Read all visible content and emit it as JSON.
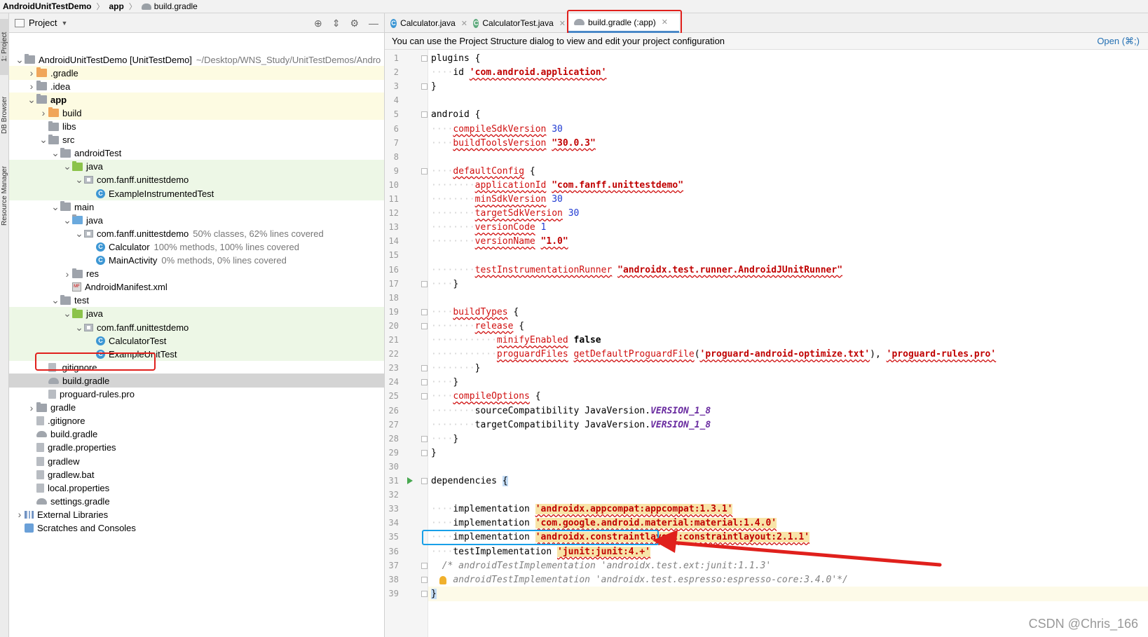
{
  "breadcrumb": {
    "project": "AndroidUnitTestDemo",
    "module": "app",
    "file": "build.gradle"
  },
  "left_strip": {
    "tab1": "1: Project",
    "tab2": "DB Browser",
    "tab3": "Resource Manager"
  },
  "project_panel": {
    "title": "Project"
  },
  "tree": [
    {
      "label": "AndroidUnitTestDemo [UnitTestDemo]",
      "hint": "~/Desktop/WNS_Study/UnitTestDemos/Andro",
      "icon": "module-folder-icon",
      "bold_part": true
    },
    {
      "label": ".gradle",
      "icon": "folder-icon"
    },
    {
      "label": ".idea",
      "icon": "folder-icon"
    },
    {
      "label": "app",
      "icon": "module-folder-icon"
    },
    {
      "label": "build",
      "icon": "folder-icon"
    },
    {
      "label": "libs",
      "icon": "folder-icon"
    },
    {
      "label": "src",
      "icon": "folder-icon"
    },
    {
      "label": "androidTest",
      "icon": "folder-icon"
    },
    {
      "label": "java",
      "icon": "test-source-folder-icon"
    },
    {
      "label": "com.fanff.unittestdemo",
      "icon": "package-icon"
    },
    {
      "label": "ExampleInstrumentedTest",
      "icon": "class-icon"
    },
    {
      "label": "main",
      "icon": "folder-icon"
    },
    {
      "label": "java",
      "icon": "source-folder-icon"
    },
    {
      "label": "com.fanff.unittestdemo",
      "hint": "50% classes, 62% lines covered",
      "icon": "package-icon"
    },
    {
      "label": "Calculator",
      "hint": "100% methods, 100% lines covered",
      "icon": "class-icon"
    },
    {
      "label": "MainActivity",
      "hint": "0% methods, 0% lines covered",
      "icon": "class-icon"
    },
    {
      "label": "res",
      "icon": "folder-icon"
    },
    {
      "label": "AndroidManifest.xml",
      "icon": "manifest-file-icon"
    },
    {
      "label": "test",
      "icon": "folder-icon"
    },
    {
      "label": "java",
      "icon": "test-source-folder-icon"
    },
    {
      "label": "com.fanff.unittestdemo",
      "icon": "package-icon"
    },
    {
      "label": "CalculatorTest",
      "icon": "test-class-icon"
    },
    {
      "label": "ExampleUnitTest",
      "icon": "test-class-icon"
    },
    {
      "label": ".gitignore",
      "icon": "file-icon"
    },
    {
      "label": "build.gradle",
      "icon": "gradle-icon"
    },
    {
      "label": "proguard-rules.pro",
      "icon": "file-icon"
    },
    {
      "label": "gradle",
      "icon": "folder-icon"
    },
    {
      "label": ".gitignore",
      "icon": "file-icon"
    },
    {
      "label": "build.gradle",
      "icon": "gradle-icon"
    },
    {
      "label": "gradle.properties",
      "icon": "properties-file-icon"
    },
    {
      "label": "gradlew",
      "icon": "file-icon"
    },
    {
      "label": "gradlew.bat",
      "icon": "file-icon"
    },
    {
      "label": "local.properties",
      "icon": "properties-file-icon"
    },
    {
      "label": "settings.gradle",
      "icon": "gradle-icon"
    },
    {
      "label": "External Libraries",
      "icon": "library-icon"
    },
    {
      "label": "Scratches and Consoles",
      "icon": "scratches-icon"
    }
  ],
  "tabs": [
    {
      "label": "Calculator.java",
      "icon": "java-class-icon"
    },
    {
      "label": "CalculatorTest.java",
      "icon": "java-test-class-icon"
    },
    {
      "label": "build.gradle (:app)",
      "icon": "gradle-icon"
    }
  ],
  "notice": {
    "text": "You can use the Project Structure dialog to view and edit your project configuration",
    "link": "Open (⌘;)"
  },
  "code": {
    "plugins": "plugins",
    "id": "id",
    "app_plugin": "'com.android.application'",
    "android": "android",
    "compileSdkVersion": "compileSdkVersion",
    "compileSdk_val": "30",
    "buildToolsVersion": "buildToolsVersion",
    "buildTools_val": "\"30.0.3\"",
    "defaultConfig": "defaultConfig",
    "applicationId": "applicationId",
    "applicationId_val": "\"com.fanff.unittestdemo\"",
    "minSdkVersion": "minSdkVersion",
    "minSdk_val": "30",
    "targetSdkVersion": "targetSdkVersion",
    "targetSdk_val": "30",
    "versionCode": "versionCode",
    "versionCode_val": "1",
    "versionName": "versionName",
    "versionName_val": "\"1.0\"",
    "testInstrumentationRunner": "testInstrumentationRunner",
    "runner_val": "\"androidx.test.runner.AndroidJUnitRunner\"",
    "buildTypes": "buildTypes",
    "release": "release",
    "minifyEnabled": "minifyEnabled",
    "false": "false",
    "proguardFiles": "proguardFiles",
    "getDefaultProguardFile": "getDefaultProguardFile",
    "proguard_opt": "'proguard-android-optimize.txt'",
    "proguard_rules": "'proguard-rules.pro'",
    "compileOptions": "compileOptions",
    "sourceCompatibility": "sourceCompatibility JavaVersion.",
    "targetCompatibility": "targetCompatibility JavaVersion.",
    "version_enum": "VERSION_1_8",
    "dependencies": "dependencies",
    "implementation": "implementation",
    "dep_appcompat": "'androidx.appcompat:appcompat:1.3.1'",
    "dep_material": "'com.google.android.material:material:1.4.0'",
    "dep_constraint": "'androidx.constraintlayout:constraintlayout:2.1.1'",
    "testImplementation": "testImplementation",
    "dep_junit": "'junit:junit:4.+'",
    "comment1": "/* androidTestImplementation 'androidx.test.ext:junit:1.1.3'",
    "comment2": "androidTestImplementation 'androidx.test.espresso:espresso-core:3.4.0'*/"
  },
  "watermark": "CSDN @Chris_166",
  "colors": {
    "annotation_red": "#e0201c",
    "annotation_blue": "#19a0e8"
  }
}
